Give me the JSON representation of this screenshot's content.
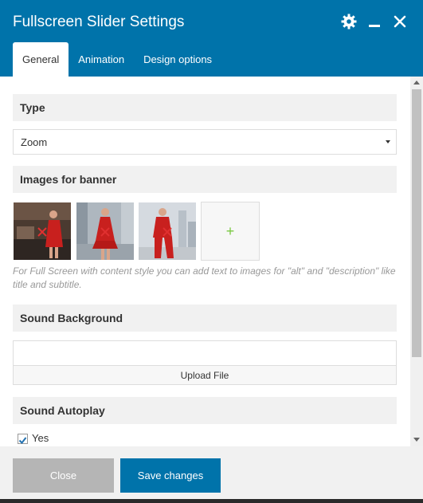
{
  "window": {
    "title": "Fullscreen Slider Settings",
    "icons": [
      "gear-icon",
      "minimize-icon",
      "close-icon"
    ]
  },
  "tabs": [
    {
      "label": "General",
      "active": true
    },
    {
      "label": "Animation",
      "active": false
    },
    {
      "label": "Design options",
      "active": false
    }
  ],
  "sections": {
    "type": {
      "heading": "Type",
      "selected": "Zoom"
    },
    "images": {
      "heading": "Images for banner",
      "thumbnails": [
        "photo-woman-red-dress-interior",
        "photo-woman-red-dress-city",
        "photo-woman-red-suit-city"
      ],
      "add_label": "+",
      "hint": "For Full Screen with content style you can add text to images for \"alt\" and \"description\" like title and subtitle."
    },
    "sound_background": {
      "heading": "Sound Background",
      "value": "",
      "upload_label": "Upload File"
    },
    "sound_autoplay": {
      "heading": "Sound Autoplay",
      "option_label": "Yes",
      "checked": true
    }
  },
  "footer": {
    "close_label": "Close",
    "save_label": "Save changes"
  },
  "colors": {
    "header": "#0073aa",
    "save_button": "#0073aa",
    "close_button": "#b5b5b5",
    "section_bg": "#f1f1f1",
    "add_icon": "#7ac943",
    "remove_icon": "#e03030"
  }
}
